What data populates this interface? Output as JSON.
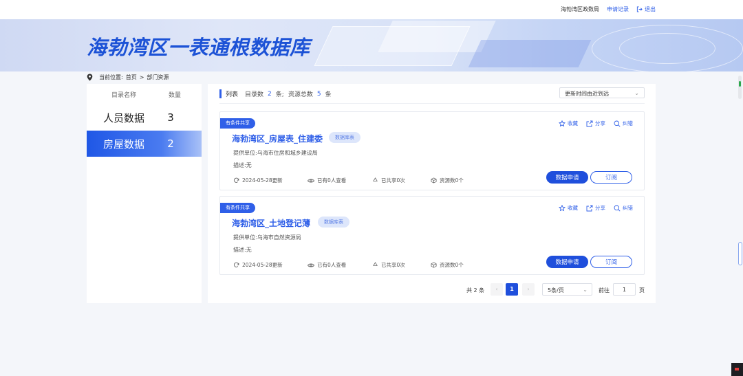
{
  "topbar": {
    "org": "海勃湾区政数局",
    "apply_records": "申请记录",
    "logout": "退出"
  },
  "banner": {
    "title": "海勃湾区一表通根数据库"
  },
  "breadcrumb": {
    "prefix": "当前位置:",
    "home": "首页",
    "separator": ">",
    "current": "部门资源"
  },
  "sidebar": {
    "col_name": "目录名称",
    "col_count": "数量",
    "items": [
      {
        "label": "人员数据",
        "count": "3",
        "active": false
      },
      {
        "label": "房屋数据",
        "count": "2",
        "active": true
      }
    ]
  },
  "summary": {
    "list_label": "列表",
    "dir_prefix": "目录数",
    "dir_count": "2",
    "dir_suffix": "条;",
    "res_prefix": "资源总数",
    "res_count": "5",
    "res_suffix": "条"
  },
  "sort": {
    "selected": "更新时间由近到远"
  },
  "actions": {
    "favorite": "收藏",
    "share": "分享",
    "correct": "纠错",
    "apply": "数据申请",
    "subscribe": "订阅"
  },
  "cards": [
    {
      "tag": "有条件共享",
      "name": "海勃湾区_房屋表_住建委",
      "type": "数据库表",
      "provider": "提供单位:乌海市住房和城乡建设局",
      "desc": "描述:无",
      "updated": "2024-05-28更新",
      "views": "已有0人查看",
      "shared": "已共享0次",
      "resources": "资源数0个"
    },
    {
      "tag": "有条件共享",
      "name": "海勃湾区_土地登记薄",
      "type": "数据库表",
      "provider": "提供单位:乌海市自然资源局",
      "desc": "描述:无",
      "updated": "2024-05-28更新",
      "views": "已有0人查看",
      "shared": "已共享0次",
      "resources": "资源数0个"
    }
  ],
  "pagination": {
    "total": "共 2 条",
    "prev": "‹",
    "current": "1",
    "next": "›",
    "page_size": "5条/页",
    "goto_label": "前往",
    "goto_value": "1",
    "page_label": "页"
  },
  "colors": {
    "accent": "#2f5fe8",
    "primary_button": "#1f4fdc"
  }
}
